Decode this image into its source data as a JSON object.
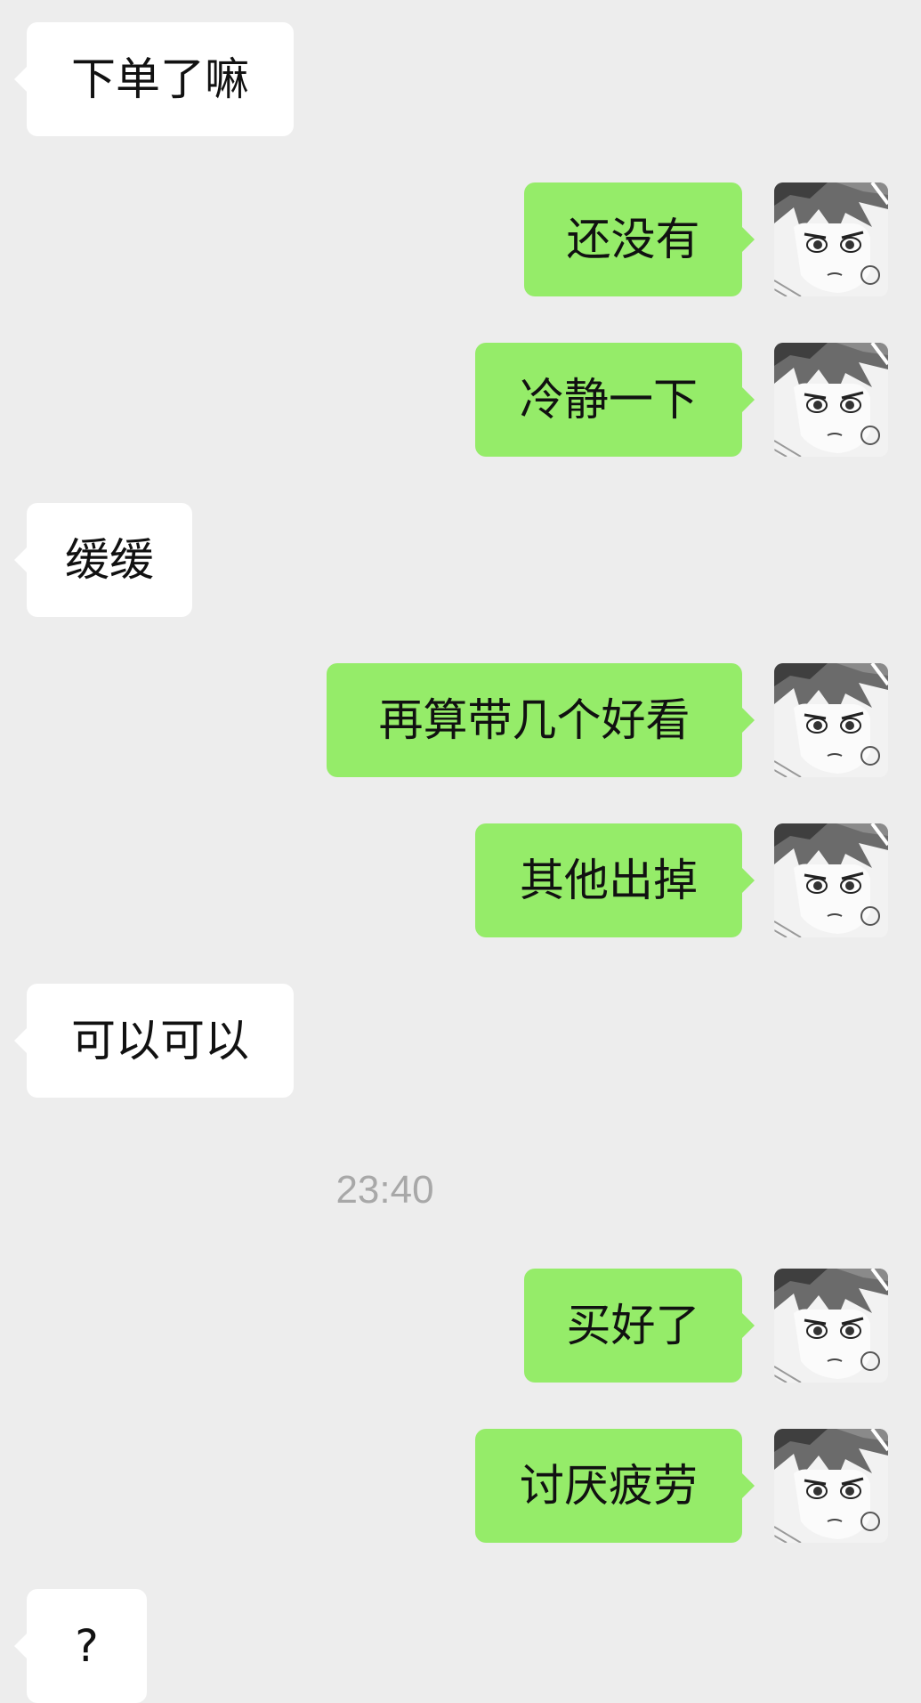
{
  "messages": [
    {
      "side": "in",
      "text": "下单了嘛"
    },
    {
      "side": "out",
      "text": "还没有"
    },
    {
      "side": "out",
      "text": "冷静一下"
    },
    {
      "side": "in",
      "text": "缓缓"
    },
    {
      "side": "out",
      "text": "再算带几个好看"
    },
    {
      "side": "out",
      "text": "其他出掉"
    },
    {
      "side": "in",
      "text": "可以可以"
    },
    {
      "side": "out",
      "text": "买好了"
    },
    {
      "side": "out",
      "text": "讨厌疲劳"
    },
    {
      "side": "in",
      "text": "?"
    }
  ],
  "timestamp": "23:40",
  "colors": {
    "background": "#ededed",
    "incoming_bubble": "#ffffff",
    "outgoing_bubble": "#95ec69",
    "timestamp_text": "#a8a8a8"
  },
  "icons": {
    "avatar": "manga-character-avatar-icon"
  }
}
